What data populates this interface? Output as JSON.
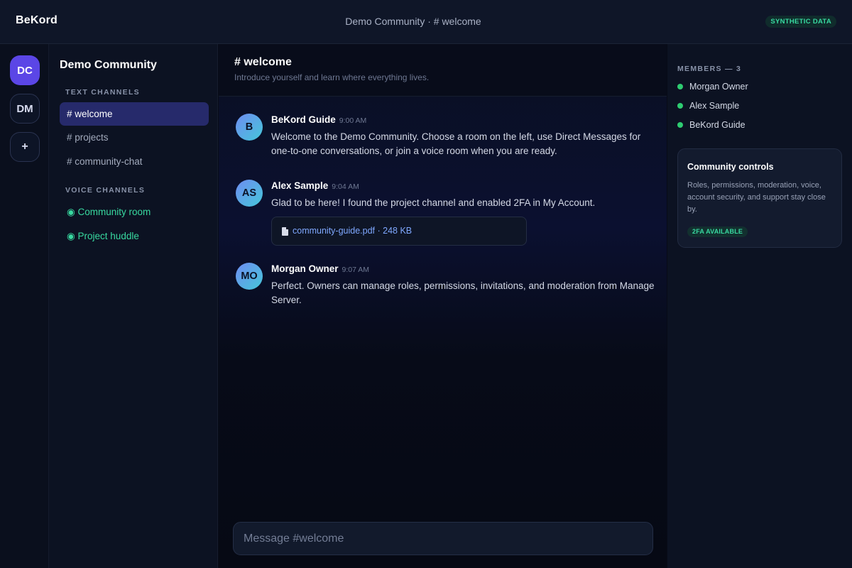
{
  "app": {
    "brand": "BeKord",
    "breadcrumb": "Demo Community · # welcome",
    "synthetic_badge": "SYNTHETIC DATA"
  },
  "servers": [
    {
      "label": "DC",
      "active": true
    },
    {
      "label": "DM",
      "active": false
    },
    {
      "label": "+",
      "active": false
    }
  ],
  "community": {
    "name": "Demo Community",
    "text_section": "TEXT CHANNELS",
    "text_channels": [
      "# welcome",
      "# projects",
      "# community-chat"
    ],
    "voice_section": "VOICE CHANNELS",
    "voice_channels": [
      "◉ Community room",
      "◉ Project huddle"
    ]
  },
  "channel": {
    "title": "# welcome",
    "topic": "Introduce yourself and learn where everything lives."
  },
  "messages": [
    {
      "initials": "B",
      "author": "BeKord Guide",
      "time": "9:00 AM",
      "text": "Welcome to the Demo Community. Choose a room on the left, use Direct Messages for one-to-one conversations, or join a voice room when you are ready."
    },
    {
      "initials": "AS",
      "author": "Alex Sample",
      "time": "9:04 AM",
      "text": "Glad to be here! I found the project channel and enabled 2FA in My Account.",
      "attachment": "community-guide.pdf · 248 KB"
    },
    {
      "initials": "MO",
      "author": "Morgan Owner",
      "time": "9:07 AM",
      "text": "Perfect. Owners can manage roles, permissions, invitations, and moderation from Manage Server."
    }
  ],
  "composer": {
    "placeholder": "Message #welcome"
  },
  "members": {
    "title": "MEMBERS — 3",
    "list": [
      "Morgan Owner",
      "Alex Sample",
      "BeKord Guide"
    ],
    "status_color": "#2ecc71"
  },
  "controls_card": {
    "title": "Community controls",
    "body": "Roles, permissions, moderation, voice, account security, and support stay close by.",
    "badge": "2FA AVAILABLE"
  },
  "colors": {
    "accent": "#5b46e6",
    "active_channel": "#262a6b",
    "voice": "#38d9a0",
    "link": "#7fa8ff"
  }
}
